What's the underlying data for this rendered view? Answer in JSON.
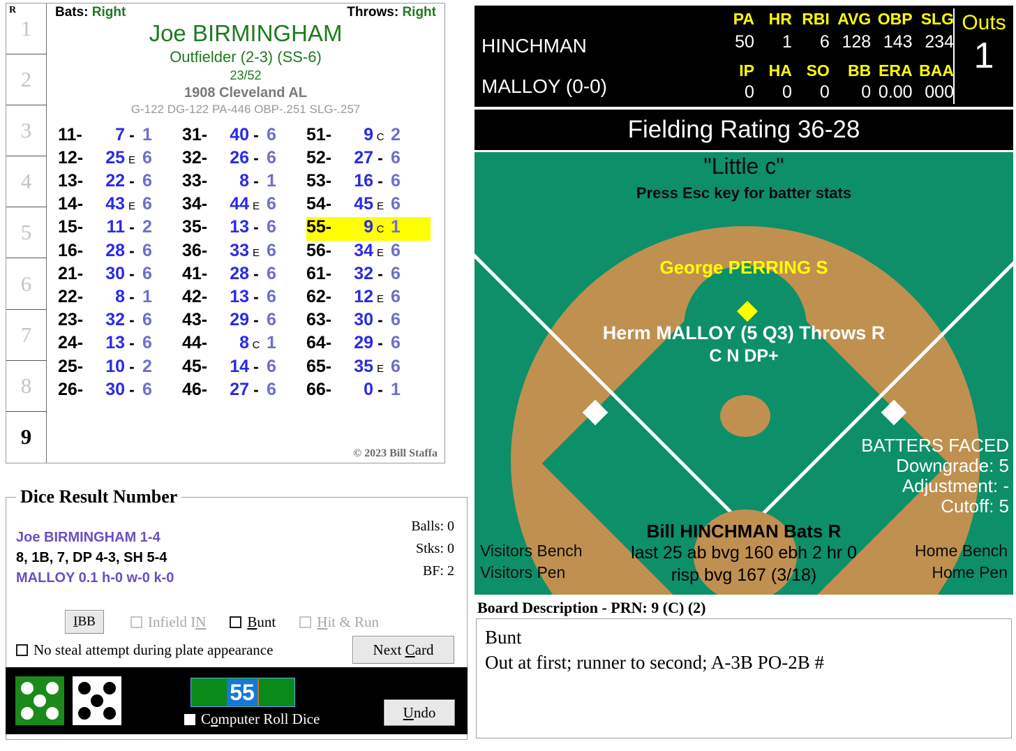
{
  "player_card": {
    "inning_header": "R",
    "innings": [
      "1",
      "2",
      "3",
      "4",
      "5",
      "6",
      "7",
      "8",
      "9"
    ],
    "current_inning_index": 8,
    "bats_label": "Bats:",
    "bats_value": "Right",
    "throws_label": "Throws:",
    "throws_value": "Right",
    "name": "Joe BIRMINGHAM",
    "position": "Outfielder (2-3) (SS-6)",
    "fraction": "23/52",
    "team": "1908 Cleveland AL",
    "stat_line": "G-122 DG-122 PA-446 OBP-.251 SLG-.257",
    "copyright": "© 2023 Bill Staffa",
    "columns": [
      [
        {
          "key": "11-",
          "num": "7",
          "flag": "-",
          "rating": "1",
          "hl": false
        },
        {
          "key": "12-",
          "num": "25",
          "flag": "E",
          "rating": "6",
          "hl": false
        },
        {
          "key": "13-",
          "num": "22",
          "flag": "-",
          "rating": "6",
          "hl": false
        },
        {
          "key": "14-",
          "num": "43",
          "flag": "E",
          "rating": "6",
          "hl": false
        },
        {
          "key": "15-",
          "num": "11",
          "flag": "-",
          "rating": "2",
          "hl": false
        },
        {
          "key": "16-",
          "num": "28",
          "flag": "-",
          "rating": "6",
          "hl": false
        },
        {
          "key": "21-",
          "num": "30",
          "flag": "-",
          "rating": "6",
          "hl": false
        },
        {
          "key": "22-",
          "num": "8",
          "flag": "-",
          "rating": "1",
          "hl": false
        },
        {
          "key": "23-",
          "num": "32",
          "flag": "-",
          "rating": "6",
          "hl": false
        },
        {
          "key": "24-",
          "num": "13",
          "flag": "-",
          "rating": "6",
          "hl": false
        },
        {
          "key": "25-",
          "num": "10",
          "flag": "-",
          "rating": "2",
          "hl": false
        },
        {
          "key": "26-",
          "num": "30",
          "flag": "-",
          "rating": "6",
          "hl": false
        }
      ],
      [
        {
          "key": "31-",
          "num": "40",
          "flag": "-",
          "rating": "6",
          "hl": false
        },
        {
          "key": "32-",
          "num": "26",
          "flag": "-",
          "rating": "6",
          "hl": false
        },
        {
          "key": "33-",
          "num": "8",
          "flag": "-",
          "rating": "1",
          "hl": false
        },
        {
          "key": "34-",
          "num": "44",
          "flag": "E",
          "rating": "6",
          "hl": false
        },
        {
          "key": "35-",
          "num": "13",
          "flag": "-",
          "rating": "6",
          "hl": false
        },
        {
          "key": "36-",
          "num": "33",
          "flag": "E",
          "rating": "6",
          "hl": false
        },
        {
          "key": "41-",
          "num": "28",
          "flag": "-",
          "rating": "6",
          "hl": false
        },
        {
          "key": "42-",
          "num": "13",
          "flag": "-",
          "rating": "6",
          "hl": false
        },
        {
          "key": "43-",
          "num": "29",
          "flag": "-",
          "rating": "6",
          "hl": false
        },
        {
          "key": "44-",
          "num": "8",
          "flag": "C",
          "rating": "1",
          "hl": false
        },
        {
          "key": "45-",
          "num": "14",
          "flag": "-",
          "rating": "6",
          "hl": false
        },
        {
          "key": "46-",
          "num": "27",
          "flag": "-",
          "rating": "6",
          "hl": false
        }
      ],
      [
        {
          "key": "51-",
          "num": "9",
          "flag": "C",
          "rating": "2",
          "hl": false
        },
        {
          "key": "52-",
          "num": "27",
          "flag": "-",
          "rating": "6",
          "hl": false
        },
        {
          "key": "53-",
          "num": "16",
          "flag": "-",
          "rating": "6",
          "hl": false
        },
        {
          "key": "54-",
          "num": "45",
          "flag": "E",
          "rating": "6",
          "hl": false
        },
        {
          "key": "55-",
          "num": "9",
          "flag": "C",
          "rating": "1",
          "hl": true
        },
        {
          "key": "56-",
          "num": "34",
          "flag": "E",
          "rating": "6",
          "hl": false
        },
        {
          "key": "61-",
          "num": "32",
          "flag": "-",
          "rating": "6",
          "hl": false
        },
        {
          "key": "62-",
          "num": "12",
          "flag": "E",
          "rating": "6",
          "hl": false
        },
        {
          "key": "63-",
          "num": "30",
          "flag": "-",
          "rating": "6",
          "hl": false
        },
        {
          "key": "64-",
          "num": "29",
          "flag": "-",
          "rating": "6",
          "hl": false
        },
        {
          "key": "65-",
          "num": "35",
          "flag": "E",
          "rating": "6",
          "hl": false
        },
        {
          "key": "66-",
          "num": "0",
          "flag": "-",
          "rating": "1",
          "hl": false
        }
      ]
    ]
  },
  "dice_result_panel": {
    "title": "Dice Result Number",
    "line1": "Joe BIRMINGHAM  1-4",
    "line2": "8, 1B, 7, DP 4-3, SH 5-4",
    "line3": "MALLOY  0.1  h-0  w-0  k-0",
    "balls": "Balls: 0",
    "strikes": "Stks: 0",
    "bf": "BF: 2",
    "ibb_label": "IBB",
    "infield_in_label": "Infield IN",
    "infield_in_checked": false,
    "infield_in_enabled": false,
    "bunt_label": "Bunt",
    "bunt_checked": false,
    "bunt_enabled": true,
    "hit_and_run_label": "Hit & Run",
    "hit_and_run_checked": false,
    "hit_and_run_enabled": false,
    "no_steal_label": "No steal attempt during plate appearance",
    "no_steal_checked": false,
    "next_card_label": "Next Card"
  },
  "dice_strip": {
    "die1_value": 5,
    "die1_color": "#1a8a1a",
    "die2_value": 5,
    "die2_color": "#ffffff",
    "result_value": "55",
    "computer_roll_label": "Computer Roll Dice",
    "computer_roll_checked": false,
    "undo_label": "Undo"
  },
  "scoreboard": {
    "batter_row_name": "HINCHMAN",
    "batter_headers": [
      "PA",
      "HR",
      "RBI",
      "AVG",
      "OBP",
      "SLG"
    ],
    "batter_values": [
      "50",
      "1",
      "6",
      "128",
      "143",
      "234"
    ],
    "pitcher_row_name": "MALLOY (0-0)",
    "pitcher_headers": [
      "IP",
      "HA",
      "SO",
      "BB",
      "ERA",
      "BAA"
    ],
    "pitcher_values": [
      "0",
      "0",
      "0",
      "0",
      "0.00",
      "000"
    ],
    "outs_label": "Outs",
    "outs_value": "1"
  },
  "field": {
    "fielding_rating": "Fielding Rating 36-28",
    "ballpark": "\"Little c\"",
    "esc_hint": "Press Esc key for batter stats",
    "shortstop": "George PERRING  S",
    "pitcher_name": "Herm MALLOY (5 Q3) Throws R",
    "pitcher_traits": "C N DP+",
    "batters_faced_title": "BATTERS FACED",
    "downgrade": "Downgrade: 5",
    "adjustment": "Adjustment: -",
    "cutoff": "Cutoff: 5",
    "batter_name": "Bill HINCHMAN Bats R",
    "batter_line1": "last 25 ab bvg 160 ebh 2 hr 0",
    "batter_line2": "risp bvg 167 (3/18)",
    "visitors_bench": "Visitors Bench",
    "visitors_pen": "Visitors Pen",
    "home_bench": "Home Bench",
    "home_pen": "Home Pen",
    "grass_color": "#0d8f69",
    "dirt_color": "#c09050"
  },
  "board_description": {
    "title": "Board Description - PRN: 9 (C) (2)",
    "line1": "Bunt",
    "line2": "Out at first; runner to second; A-3B PO-2B #"
  }
}
